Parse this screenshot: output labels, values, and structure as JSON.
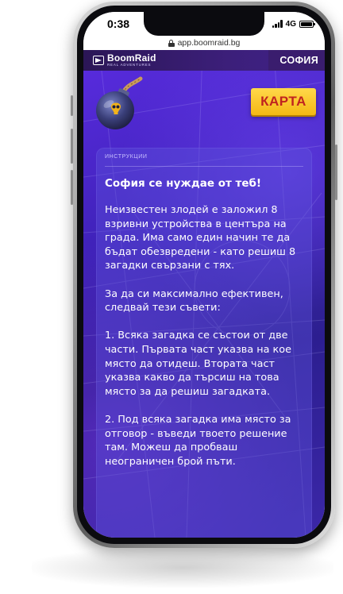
{
  "status_bar": {
    "time": "0:38",
    "network": "4G"
  },
  "browser": {
    "url": "app.boomraid.bg"
  },
  "header": {
    "logo_name": "BoomRaid",
    "logo_tagline": "REAL ADVENTURES",
    "city": "СОФИЯ"
  },
  "map_button": {
    "label": "КАРТА"
  },
  "instructions": {
    "section_label": "ИНСТРУКЦИИ",
    "title": "София се нуждае от теб!",
    "paragraphs": [
      "Неизвестен злодей е заложил 8 взривни устройства в центъра на града. Има само един начин те да бъдат обезвредени - като решиш 8 загадки свързани с тях.",
      "За да си максимално ефективен, следвай тези съвети:",
      "1. Всяка загадка се състои от две части. Първата част указва на кое място да отидеш. Втората част указва какво да търсиш на това място за да решиш загадката.",
      "2. Под всяка загадка има място за отговор - въведи твоето решение там. Можеш да пробваш неограничен брой пъти."
    ]
  },
  "colors": {
    "app_background": "#3f22b9",
    "header_background": "#2b1656",
    "map_button": "#f4b814",
    "map_button_text": "#c0231f",
    "card_background": "#5c50dc"
  },
  "icons": {
    "bomb": "bomb-icon",
    "lock": "lock-icon",
    "logo": "boomraid-logo-icon"
  }
}
